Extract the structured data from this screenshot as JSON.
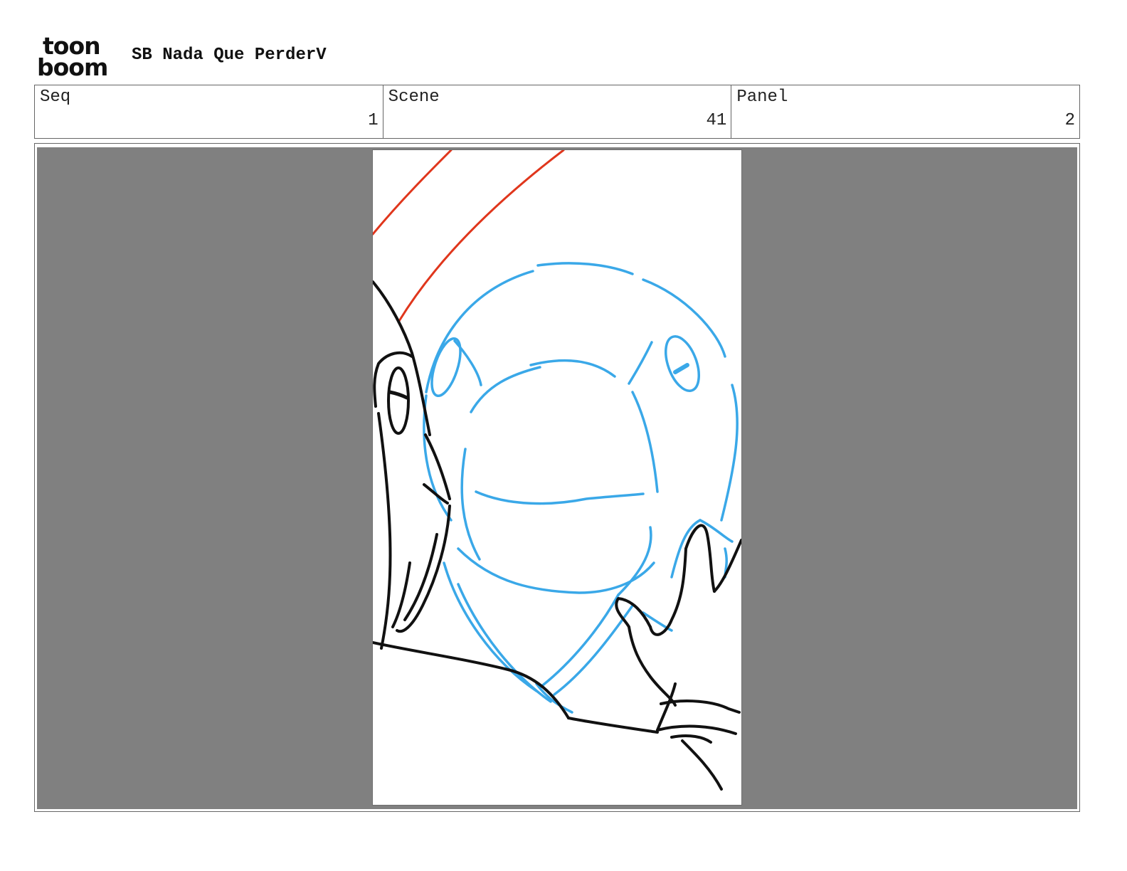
{
  "header": {
    "logo_top": "toon",
    "logo_bottom": "boom",
    "title": "SB Nada Que PerderV"
  },
  "fields": [
    {
      "label": "Seq",
      "value": "1"
    },
    {
      "label": "Scene",
      "value": "41"
    },
    {
      "label": "Panel",
      "value": "2"
    }
  ],
  "drawing": {
    "colors": {
      "background": "#808080",
      "paper": "#ffffff",
      "rough_blue": "#3aa8e8",
      "ink_black": "#111111",
      "red_line": "#e0361c"
    }
  }
}
